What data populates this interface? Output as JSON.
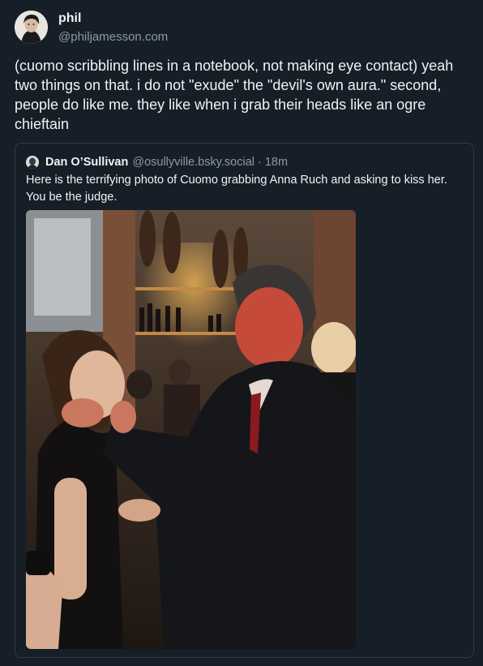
{
  "author": {
    "display_name": "phil",
    "handle": "@philjamesson.com"
  },
  "post": {
    "text": "(cuomo scribbling lines in a notebook, not making eye contact) yeah two things on that. i do not \"exude\" the \"devil's own aura.\" second, people do like me. they like when i grab their heads like an ogre chieftain"
  },
  "quoted": {
    "display_name": "Dan O’Sullivan",
    "handle": "@osullyville.bsky.social",
    "separator": "·",
    "time": "18m",
    "text": "Here is the terrifying photo of Cuomo grabbing Anna Ruch and asking to kiss her. You be the judge.",
    "image_subject": "photo-cuomo-grabbing-woman"
  },
  "colors": {
    "background": "#161e27",
    "text_primary": "#f1f3f5",
    "text_secondary": "#8d9aa9",
    "quote_border": "#2e3a48"
  }
}
